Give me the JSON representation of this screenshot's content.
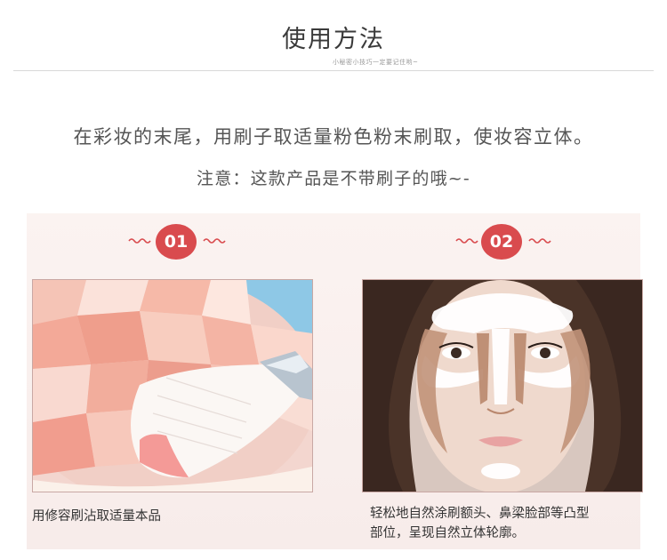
{
  "header": {
    "title": "使用方法",
    "subtitle": "小秘密小技巧一定要记住哟~"
  },
  "instruction": "在彩妆的末尾，用刷子取适量粉色粉末刷取，使妆容立体。",
  "note": "注意：这款产品是不带刷子的哦~-",
  "steps": [
    {
      "number": "01",
      "caption": "用修容刷沾取适量本品"
    },
    {
      "number": "02",
      "caption_line1": "轻松地自然涂刷额头、鼻梁脸部等凸型",
      "caption_line2": "部位，呈现自然立体轮廓。"
    }
  ],
  "colors": {
    "accent": "#d94b4e",
    "panel": "#f8eeec"
  },
  "images": [
    "powder-brush-photo",
    "face-contour-photo"
  ]
}
